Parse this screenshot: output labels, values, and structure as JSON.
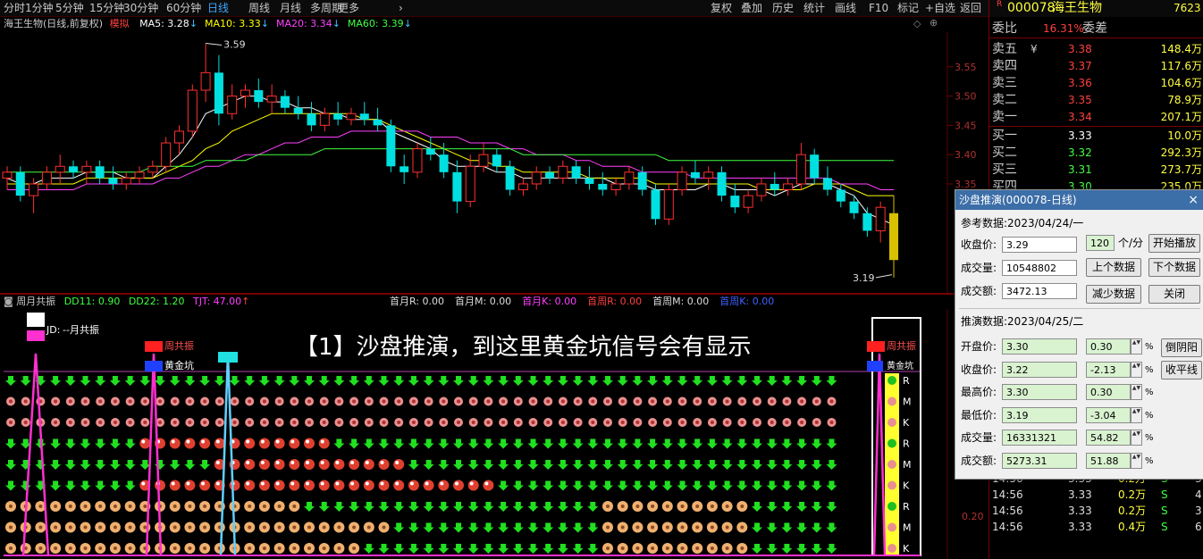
{
  "toolbar": {
    "periods": [
      "分时",
      "1分钟",
      "5分钟",
      "15分钟",
      "30分钟",
      "60分钟",
      "日线",
      "周线",
      "月线",
      "多周期",
      "更多"
    ],
    "active_period": "日线",
    "tools": [
      "复权",
      "叠加",
      "历史",
      "统计",
      "画线",
      "F10",
      "标记",
      "+自选",
      "返回"
    ]
  },
  "chart_info": {
    "stock_label": "海王生物(日线,前复权)",
    "mode_label": "模拟",
    "ma": [
      {
        "name": "MA5",
        "value": "3.28",
        "color": "#ffffff"
      },
      {
        "name": "MA10",
        "value": "3.33",
        "color": "#ffff00"
      },
      {
        "name": "MA20",
        "value": "3.34",
        "color": "#ff40ff"
      },
      {
        "name": "MA60",
        "value": "3.39",
        "color": "#40ff40"
      }
    ],
    "high_label": "3.59",
    "low_label": "3.19",
    "price_ticks": [
      "3.55",
      "3.50",
      "3.45",
      "3.40",
      "3.35"
    ],
    "sub_ticks": [
      "0.20"
    ]
  },
  "chart_data": {
    "type": "candlestick",
    "ylim": [
      3.17,
      3.6
    ],
    "candles": [
      [
        3.36,
        3.38,
        3.34,
        3.37
      ],
      [
        3.37,
        3.38,
        3.32,
        3.33
      ],
      [
        3.33,
        3.36,
        3.3,
        3.35
      ],
      [
        3.35,
        3.38,
        3.34,
        3.37
      ],
      [
        3.37,
        3.4,
        3.35,
        3.38
      ],
      [
        3.38,
        3.39,
        3.36,
        3.37
      ],
      [
        3.37,
        3.39,
        3.35,
        3.38
      ],
      [
        3.38,
        3.39,
        3.35,
        3.36
      ],
      [
        3.36,
        3.38,
        3.34,
        3.35
      ],
      [
        3.35,
        3.37,
        3.34,
        3.36
      ],
      [
        3.36,
        3.38,
        3.35,
        3.37
      ],
      [
        3.37,
        3.39,
        3.36,
        3.38
      ],
      [
        3.38,
        3.43,
        3.37,
        3.42
      ],
      [
        3.42,
        3.45,
        3.4,
        3.44
      ],
      [
        3.44,
        3.52,
        3.43,
        3.51
      ],
      [
        3.51,
        3.59,
        3.49,
        3.54
      ],
      [
        3.54,
        3.57,
        3.45,
        3.47
      ],
      [
        3.47,
        3.52,
        3.46,
        3.5
      ],
      [
        3.5,
        3.52,
        3.48,
        3.51
      ],
      [
        3.51,
        3.53,
        3.48,
        3.49
      ],
      [
        3.49,
        3.52,
        3.47,
        3.5
      ],
      [
        3.5,
        3.51,
        3.47,
        3.48
      ],
      [
        3.48,
        3.5,
        3.46,
        3.47
      ],
      [
        3.47,
        3.49,
        3.44,
        3.45
      ],
      [
        3.45,
        3.48,
        3.44,
        3.47
      ],
      [
        3.47,
        3.49,
        3.45,
        3.46
      ],
      [
        3.46,
        3.48,
        3.45,
        3.47
      ],
      [
        3.47,
        3.49,
        3.45,
        3.46
      ],
      [
        3.46,
        3.48,
        3.44,
        3.45
      ],
      [
        3.45,
        3.46,
        3.37,
        3.38
      ],
      [
        3.38,
        3.4,
        3.35,
        3.37
      ],
      [
        3.37,
        3.42,
        3.36,
        3.41
      ],
      [
        3.41,
        3.43,
        3.39,
        3.4
      ],
      [
        3.4,
        3.42,
        3.36,
        3.37
      ],
      [
        3.37,
        3.39,
        3.3,
        3.32
      ],
      [
        3.32,
        3.4,
        3.31,
        3.38
      ],
      [
        3.38,
        3.42,
        3.37,
        3.4
      ],
      [
        3.4,
        3.41,
        3.37,
        3.38
      ],
      [
        3.38,
        3.39,
        3.33,
        3.34
      ],
      [
        3.34,
        3.36,
        3.33,
        3.35
      ],
      [
        3.35,
        3.38,
        3.34,
        3.37
      ],
      [
        3.37,
        3.38,
        3.35,
        3.36
      ],
      [
        3.36,
        3.39,
        3.35,
        3.38
      ],
      [
        3.38,
        3.39,
        3.35,
        3.36
      ],
      [
        3.36,
        3.38,
        3.34,
        3.35
      ],
      [
        3.35,
        3.37,
        3.33,
        3.34
      ],
      [
        3.34,
        3.36,
        3.33,
        3.35
      ],
      [
        3.35,
        3.38,
        3.34,
        3.37
      ],
      [
        3.37,
        3.38,
        3.33,
        3.34
      ],
      [
        3.34,
        3.35,
        3.28,
        3.29
      ],
      [
        3.29,
        3.35,
        3.28,
        3.34
      ],
      [
        3.34,
        3.38,
        3.33,
        3.37
      ],
      [
        3.37,
        3.39,
        3.35,
        3.36
      ],
      [
        3.36,
        3.38,
        3.34,
        3.37
      ],
      [
        3.37,
        3.38,
        3.32,
        3.33
      ],
      [
        3.33,
        3.35,
        3.3,
        3.31
      ],
      [
        3.31,
        3.34,
        3.3,
        3.33
      ],
      [
        3.33,
        3.36,
        3.32,
        3.35
      ],
      [
        3.35,
        3.37,
        3.33,
        3.34
      ],
      [
        3.34,
        3.36,
        3.33,
        3.35
      ],
      [
        3.35,
        3.42,
        3.34,
        3.4
      ],
      [
        3.4,
        3.41,
        3.35,
        3.36
      ],
      [
        3.36,
        3.38,
        3.33,
        3.34
      ],
      [
        3.34,
        3.35,
        3.31,
        3.32
      ],
      [
        3.32,
        3.33,
        3.29,
        3.3
      ],
      [
        3.3,
        3.31,
        3.26,
        3.27
      ],
      [
        3.27,
        3.32,
        3.25,
        3.31
      ],
      [
        3.3,
        3.33,
        3.19,
        3.22
      ]
    ],
    "ma5": [
      3.36,
      3.35,
      3.35,
      3.36,
      3.36,
      3.36,
      3.37,
      3.37,
      3.37,
      3.36,
      3.36,
      3.36,
      3.38,
      3.4,
      3.43,
      3.47,
      3.48,
      3.49,
      3.5,
      3.5,
      3.49,
      3.49,
      3.48,
      3.48,
      3.47,
      3.47,
      3.46,
      3.46,
      3.46,
      3.44,
      3.43,
      3.42,
      3.41,
      3.39,
      3.38,
      3.38,
      3.38,
      3.37,
      3.37,
      3.36,
      3.36,
      3.36,
      3.36,
      3.36,
      3.36,
      3.36,
      3.35,
      3.35,
      3.35,
      3.34,
      3.34,
      3.34,
      3.34,
      3.35,
      3.35,
      3.34,
      3.34,
      3.34,
      3.33,
      3.34,
      3.35,
      3.35,
      3.35,
      3.34,
      3.33,
      3.3,
      3.29,
      3.28
    ],
    "ma10": [
      3.35,
      3.35,
      3.35,
      3.35,
      3.35,
      3.35,
      3.36,
      3.36,
      3.36,
      3.36,
      3.36,
      3.36,
      3.37,
      3.38,
      3.39,
      3.41,
      3.42,
      3.44,
      3.45,
      3.46,
      3.47,
      3.47,
      3.47,
      3.47,
      3.47,
      3.47,
      3.47,
      3.46,
      3.46,
      3.45,
      3.44,
      3.43,
      3.42,
      3.41,
      3.4,
      3.39,
      3.39,
      3.38,
      3.38,
      3.37,
      3.37,
      3.37,
      3.37,
      3.37,
      3.36,
      3.36,
      3.36,
      3.36,
      3.36,
      3.35,
      3.35,
      3.35,
      3.35,
      3.35,
      3.35,
      3.35,
      3.35,
      3.34,
      3.34,
      3.34,
      3.34,
      3.35,
      3.35,
      3.35,
      3.34,
      3.33,
      3.33,
      3.33
    ],
    "ma20": [
      3.34,
      3.34,
      3.34,
      3.34,
      3.34,
      3.34,
      3.35,
      3.35,
      3.35,
      3.35,
      3.35,
      3.35,
      3.36,
      3.36,
      3.37,
      3.38,
      3.38,
      3.39,
      3.4,
      3.4,
      3.41,
      3.42,
      3.42,
      3.43,
      3.43,
      3.43,
      3.44,
      3.44,
      3.44,
      3.44,
      3.44,
      3.44,
      3.43,
      3.43,
      3.43,
      3.42,
      3.42,
      3.42,
      3.41,
      3.41,
      3.4,
      3.4,
      3.4,
      3.39,
      3.39,
      3.38,
      3.38,
      3.38,
      3.37,
      3.37,
      3.37,
      3.37,
      3.36,
      3.36,
      3.36,
      3.36,
      3.36,
      3.36,
      3.36,
      3.36,
      3.36,
      3.36,
      3.36,
      3.35,
      3.35,
      3.35,
      3.34,
      3.34
    ],
    "ma60": [
      3.37,
      3.37,
      3.37,
      3.37,
      3.37,
      3.37,
      3.37,
      3.37,
      3.37,
      3.37,
      3.37,
      3.38,
      3.38,
      3.38,
      3.38,
      3.39,
      3.39,
      3.39,
      3.39,
      3.4,
      3.4,
      3.4,
      3.4,
      3.4,
      3.41,
      3.41,
      3.41,
      3.41,
      3.41,
      3.41,
      3.41,
      3.41,
      3.41,
      3.41,
      3.41,
      3.41,
      3.41,
      3.41,
      3.41,
      3.4,
      3.4,
      3.4,
      3.4,
      3.4,
      3.4,
      3.4,
      3.4,
      3.4,
      3.4,
      3.4,
      3.39,
      3.39,
      3.39,
      3.39,
      3.39,
      3.39,
      3.39,
      3.39,
      3.39,
      3.39,
      3.39,
      3.39,
      3.39,
      3.39,
      3.39,
      3.39,
      3.39,
      3.39
    ]
  },
  "sub_info": {
    "title": "周月共振",
    "dd11": "DD11: 0.90",
    "dd22": "DD22: 1.20",
    "tjt": "TJT: 47.00",
    "fields": [
      "首月R: 0.00",
      "首月M: 0.00",
      "首月K: 0.00",
      "首周R: 0.00",
      "首周M: 0.00",
      "首周K: 0.00"
    ]
  },
  "sub_labels": {
    "yue_gongzhen": "--月共振",
    "zhou_gongzhen": "周共振",
    "huang_jin_keng": "黄金坑",
    "zhou_gongzhen_right": "周共振",
    "keng_right": "黄金坑",
    "prefix_jd": "JD:",
    "side_letters": [
      "R",
      "M",
      "K",
      "R",
      "M",
      "K",
      "R",
      "M",
      "K"
    ],
    "annotation": "【1】沙盘推演，到这里黄金坑信号会有显示"
  },
  "right_panel": {
    "marker": "R",
    "code": "000078",
    "name": "海王生物",
    "last": "7623",
    "weibi_label": "委比",
    "weibi_value": "16.31%",
    "weicha_label": "委差",
    "asks": [
      {
        "label": "卖五",
        "price": "3.38",
        "vol": "148.4",
        "unit": "万",
        "sym": "¥"
      },
      {
        "label": "卖四",
        "price": "3.37",
        "vol": "117.6",
        "unit": "万"
      },
      {
        "label": "卖三",
        "price": "3.36",
        "vol": "104.6",
        "unit": "万"
      },
      {
        "label": "卖二",
        "price": "3.35",
        "vol": "78.9",
        "unit": "万"
      },
      {
        "label": "卖一",
        "price": "3.34",
        "vol": "207.1",
        "unit": "万"
      }
    ],
    "bids": [
      {
        "label": "买一",
        "price": "3.33",
        "vol": "10.0",
        "unit": "万",
        "color": "#ffffff"
      },
      {
        "label": "买二",
        "price": "3.32",
        "vol": "292.3",
        "unit": "万",
        "color": "#40ff40"
      },
      {
        "label": "买三",
        "price": "3.31",
        "vol": "273.7",
        "unit": "万",
        "color": "#40ff40"
      },
      {
        "label": "买四",
        "price": "3.30",
        "vol": "235.0",
        "unit": "万",
        "color": "#40ff40"
      }
    ],
    "ticks": [
      {
        "time": "14:56",
        "price": "3.33",
        "vol": "0.2万",
        "side": "S",
        "n": "3"
      },
      {
        "time": "14:56",
        "price": "3.33",
        "vol": "0.2万",
        "side": "S",
        "n": "4"
      },
      {
        "time": "14:56",
        "price": "3.33",
        "vol": "0.2万",
        "side": "S",
        "n": "3"
      },
      {
        "time": "14:56",
        "price": "3.33",
        "vol": "0.4万",
        "side": "S",
        "n": "6"
      }
    ]
  },
  "dialog": {
    "title": "沙盘推演(000078-日线)",
    "close": "×",
    "ref_label": "参考数据:2023/04/24/一",
    "close_price_label": "收盘价:",
    "close_price": "3.29",
    "speed": "120",
    "speed_unit": "个/分",
    "volume_label": "成交量:",
    "volume": "10548802",
    "amount_label": "成交额:",
    "amount": "3472.13",
    "btn_play": "开始播放",
    "btn_prev": "上个数据",
    "btn_next": "下个数据",
    "btn_less": "减少数据",
    "btn_close": "关闭",
    "calc_label": "推演数据:2023/04/25/二",
    "rows": [
      {
        "label": "开盘价:",
        "value": "3.30",
        "pct": "0.30",
        "unit": "%"
      },
      {
        "label": "收盘价:",
        "value": "3.22",
        "pct": "-2.13",
        "unit": "%"
      },
      {
        "label": "最高价:",
        "value": "3.30",
        "pct": "0.30",
        "unit": "%"
      },
      {
        "label": "最低价:",
        "value": "3.19",
        "pct": "-3.04",
        "unit": "%"
      },
      {
        "label": "成交量:",
        "value": "16331321",
        "pct": "54.82",
        "unit": "%"
      },
      {
        "label": "成交额:",
        "value": "5273.31",
        "pct": "51.88",
        "unit": "%"
      }
    ],
    "btn_yinyang": "倒阴阳",
    "btn_flat": "收平线"
  }
}
